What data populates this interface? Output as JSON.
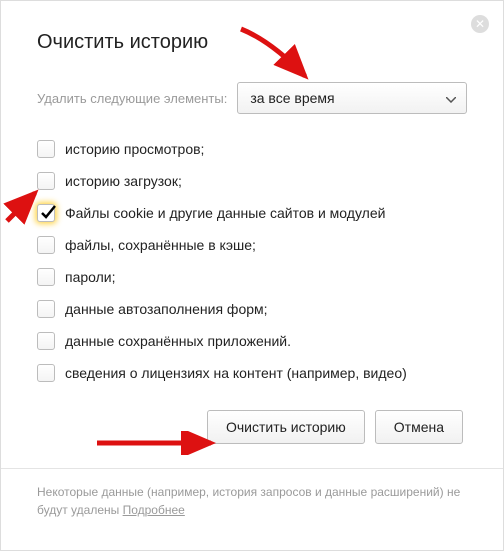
{
  "title": "Очистить историю",
  "filter": {
    "label": "Удалить следующие элементы:",
    "selected": "за все время"
  },
  "options": [
    {
      "label": "историю просмотров;",
      "checked": false
    },
    {
      "label": "историю загрузок;",
      "checked": false
    },
    {
      "label": "Файлы cookie и другие данные сайтов и модулей",
      "checked": true
    },
    {
      "label": "файлы, сохранённые в кэше;",
      "checked": false
    },
    {
      "label": "пароли;",
      "checked": false
    },
    {
      "label": "данные автозаполнения форм;",
      "checked": false
    },
    {
      "label": "данные сохранённых приложений.",
      "checked": false
    },
    {
      "label": "сведения о лицензиях на контент (например, видео)",
      "checked": false
    }
  ],
  "buttons": {
    "clear": "Очистить историю",
    "cancel": "Отмена"
  },
  "footer": {
    "text": "Некоторые данные (например, история запросов и данные расширений) не будут удалены ",
    "link": "Подробнее"
  },
  "icons": {
    "close": "✕"
  }
}
